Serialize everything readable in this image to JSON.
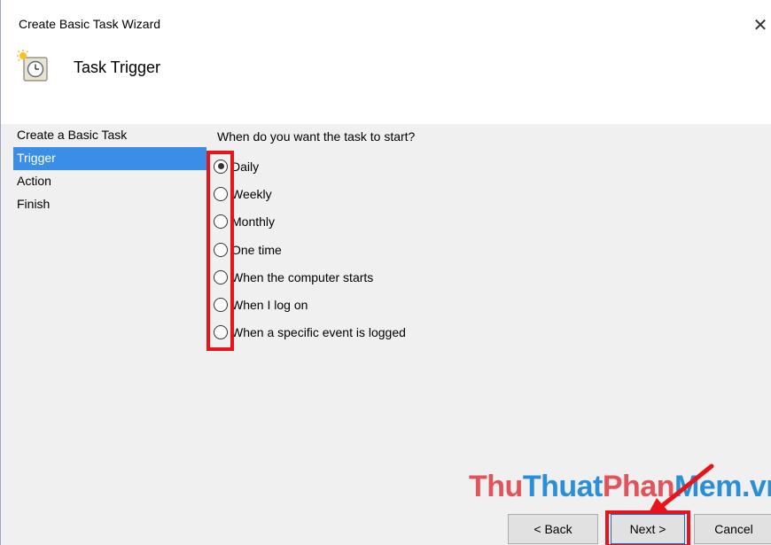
{
  "window": {
    "title": "Create Basic Task Wizard",
    "close_glyph": "✕"
  },
  "header": {
    "title": "Task Trigger",
    "icon": "clock-task-icon"
  },
  "nav": {
    "items": [
      {
        "label": "Create a Basic Task",
        "selected": false
      },
      {
        "label": "Trigger",
        "selected": true
      },
      {
        "label": "Action",
        "selected": false
      },
      {
        "label": "Finish",
        "selected": false
      }
    ]
  },
  "trigger": {
    "question": "When do you want the task to start?",
    "options": [
      {
        "label": "Daily",
        "checked": true
      },
      {
        "label": "Weekly",
        "checked": false
      },
      {
        "label": "Monthly",
        "checked": false
      },
      {
        "label": "One time",
        "checked": false
      },
      {
        "label": "When the computer starts",
        "checked": false
      },
      {
        "label": "When I log on",
        "checked": false
      },
      {
        "label": "When a specific event is logged",
        "checked": false
      }
    ]
  },
  "watermark": {
    "part1": "Thu",
    "part2": "Thuat",
    "part3": "Phan",
    "part4": "Mem",
    "part5": ".vn"
  },
  "buttons": {
    "back": "< Back",
    "next": "Next >",
    "cancel": "Cancel"
  },
  "colors": {
    "selection": "#3a8ee6",
    "highlight": "#e8141c",
    "content_bg": "#f0f0f0"
  }
}
